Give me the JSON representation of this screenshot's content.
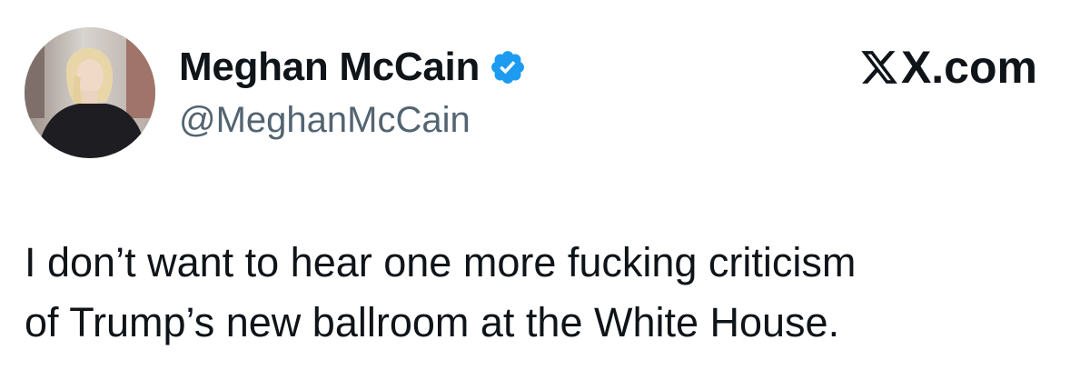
{
  "tweet": {
    "author": {
      "display_name": "Meghan McCain",
      "handle": "@MeghanMcCain",
      "verified": true,
      "avatar_icon": "profile-photo"
    },
    "source": "X.com",
    "text_lines": [
      "I don’t want to hear one more fucking criticism",
      "of Trump’s new ballroom at the White House."
    ]
  },
  "colors": {
    "text": "#0f1419",
    "handle": "#536471",
    "verified_badge": "#1d9bf0",
    "background": "#ffffff"
  }
}
